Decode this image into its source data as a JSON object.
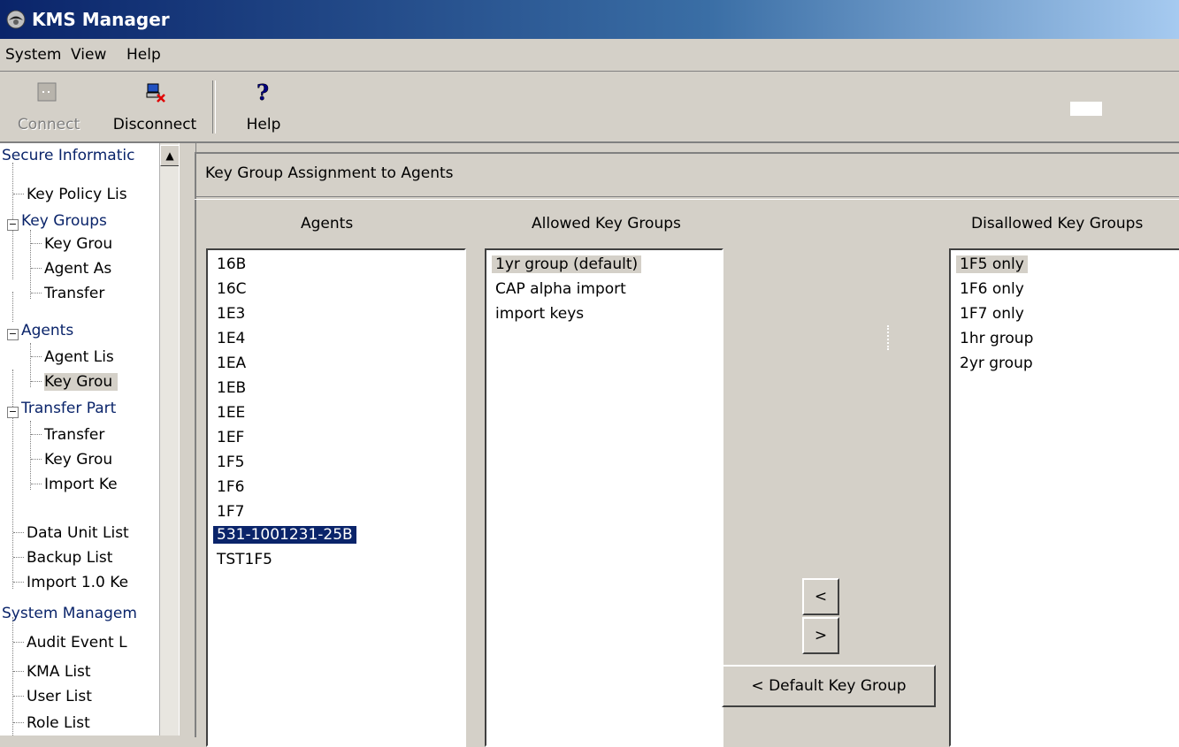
{
  "window": {
    "title": "KMS Manager"
  },
  "menu": {
    "items": [
      "System",
      "View",
      "Help"
    ]
  },
  "toolbar": {
    "connect_label": "Connect",
    "disconnect_label": "Disconnect",
    "help_label": "Help"
  },
  "tree": {
    "items": [
      "Secure Informatic",
      "Key Policy Lis",
      "Key Groups",
      "Key Grou",
      "Agent As",
      "Transfer",
      "Agents",
      "Agent Lis",
      "Key Grou",
      "Transfer Part",
      "Transfer",
      "Key Grou",
      "Import Ke",
      "Data Unit List",
      "Backup List",
      "Import 1.0 Ke",
      "System Managem",
      "Audit Event L",
      "KMA List",
      "User List",
      "Role List"
    ]
  },
  "panel": {
    "title": "Key Group Assignment to Agents",
    "agents_header": "Agents",
    "allowed_header": "Allowed Key Groups",
    "disallowed_header": "Disallowed Key Groups",
    "agents": [
      "16B",
      "16C",
      "1E3",
      "1E4",
      "1EA",
      "1EB",
      "1EE",
      "1EF",
      "1F5",
      "1F6",
      "1F7",
      "531-1001231-25B",
      "TST1F5"
    ],
    "allowed": [
      "1yr group (default)",
      "CAP alpha import",
      "import keys"
    ],
    "disallowed": [
      "1F5 only",
      "1F6 only",
      "1F7 only",
      "1hr group",
      "2yr group"
    ],
    "move_left_label": "<",
    "move_right_label": ">",
    "default_key_group_label": "< Default Key Group"
  }
}
